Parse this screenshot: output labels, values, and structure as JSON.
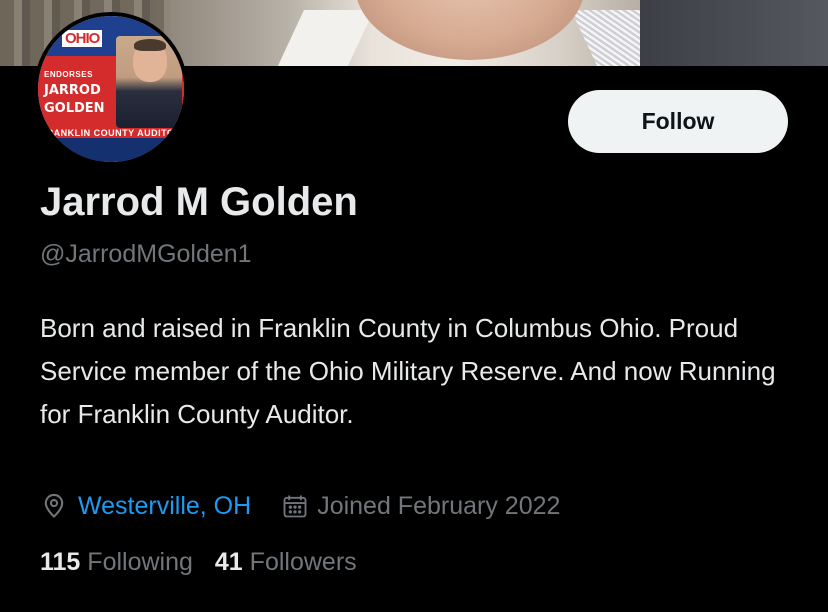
{
  "profile": {
    "display_name": "Jarrod M Golden",
    "handle": "@JarrodMGolden1",
    "bio": "Born and raised in Franklin County in Columbus Ohio. Proud Service member of the Ohio Military Reserve. And now Running for Franklin County Auditor.",
    "location": "Westerville, OH",
    "joined": "Joined February 2022",
    "following_count": "115",
    "following_label": "Following",
    "followers_count": "41",
    "followers_label": "Followers"
  },
  "actions": {
    "follow_label": "Follow"
  },
  "avatar": {
    "ohio_text": "OHIO",
    "endorses": "ENDORSES",
    "name_line1": "JARROD",
    "name_line2": "GOLDEN",
    "office": "FRANKLIN COUNTY AUDITOR"
  },
  "icons": {
    "location": "location-pin-icon",
    "joined": "calendar-icon"
  },
  "colors": {
    "link": "#1d9bf0",
    "muted": "#71767b",
    "text": "#e7e9ea",
    "background": "#000000"
  }
}
